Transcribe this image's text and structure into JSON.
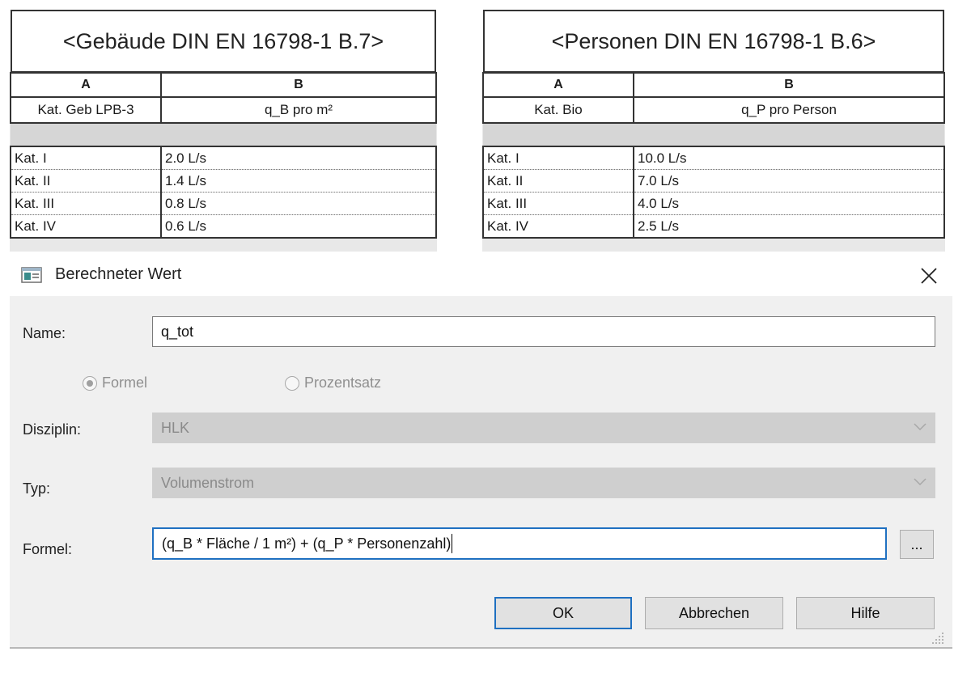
{
  "schedules": [
    {
      "title": "<Gebäude DIN EN 16798-1 B.7>",
      "col_letters": [
        "A",
        "B"
      ],
      "headers": [
        "Kat. Geb LPB-3",
        "q_B pro m²"
      ],
      "rows": [
        [
          "Kat. I",
          "2.0 L/s"
        ],
        [
          "Kat. II",
          "1.4 L/s"
        ],
        [
          "Kat. III",
          "0.8 L/s"
        ],
        [
          "Kat. IV",
          "0.6 L/s"
        ]
      ]
    },
    {
      "title": "<Personen DIN EN 16798-1 B.6>",
      "col_letters": [
        "A",
        "B"
      ],
      "headers": [
        "Kat. Bio",
        "q_P pro Person"
      ],
      "rows": [
        [
          "Kat. I",
          "10.0 L/s"
        ],
        [
          "Kat. II",
          "7.0 L/s"
        ],
        [
          "Kat. III",
          "4.0 L/s"
        ],
        [
          "Kat. IV",
          "2.5 L/s"
        ]
      ]
    }
  ],
  "dialog": {
    "title": "Berechneter Wert",
    "name_label": "Name:",
    "name_value": "q_tot",
    "radio_formula": "Formel",
    "radio_percent": "Prozentsatz",
    "radio_selected": "Formel",
    "discipline_label": "Disziplin:",
    "discipline_value": "HLK",
    "type_label": "Typ:",
    "type_value": "Volumenstrom",
    "formula_label": "Formel:",
    "formula_value": "(q_B * Fläche / 1 m²) + (q_P * Personenzahl)",
    "browse_label": "...",
    "ok_label": "OK",
    "cancel_label": "Abbrechen",
    "help_label": "Hilfe"
  },
  "icons": {
    "dialog": "dialog-window-icon",
    "close": "close-icon",
    "dropdown": "chevron-down-icon",
    "resize": "resize-grip-icon"
  },
  "colors": {
    "focus_border": "#1f70c1",
    "dialog_background": "#f0f0f0",
    "disabled_field": "#cfcfcf"
  }
}
